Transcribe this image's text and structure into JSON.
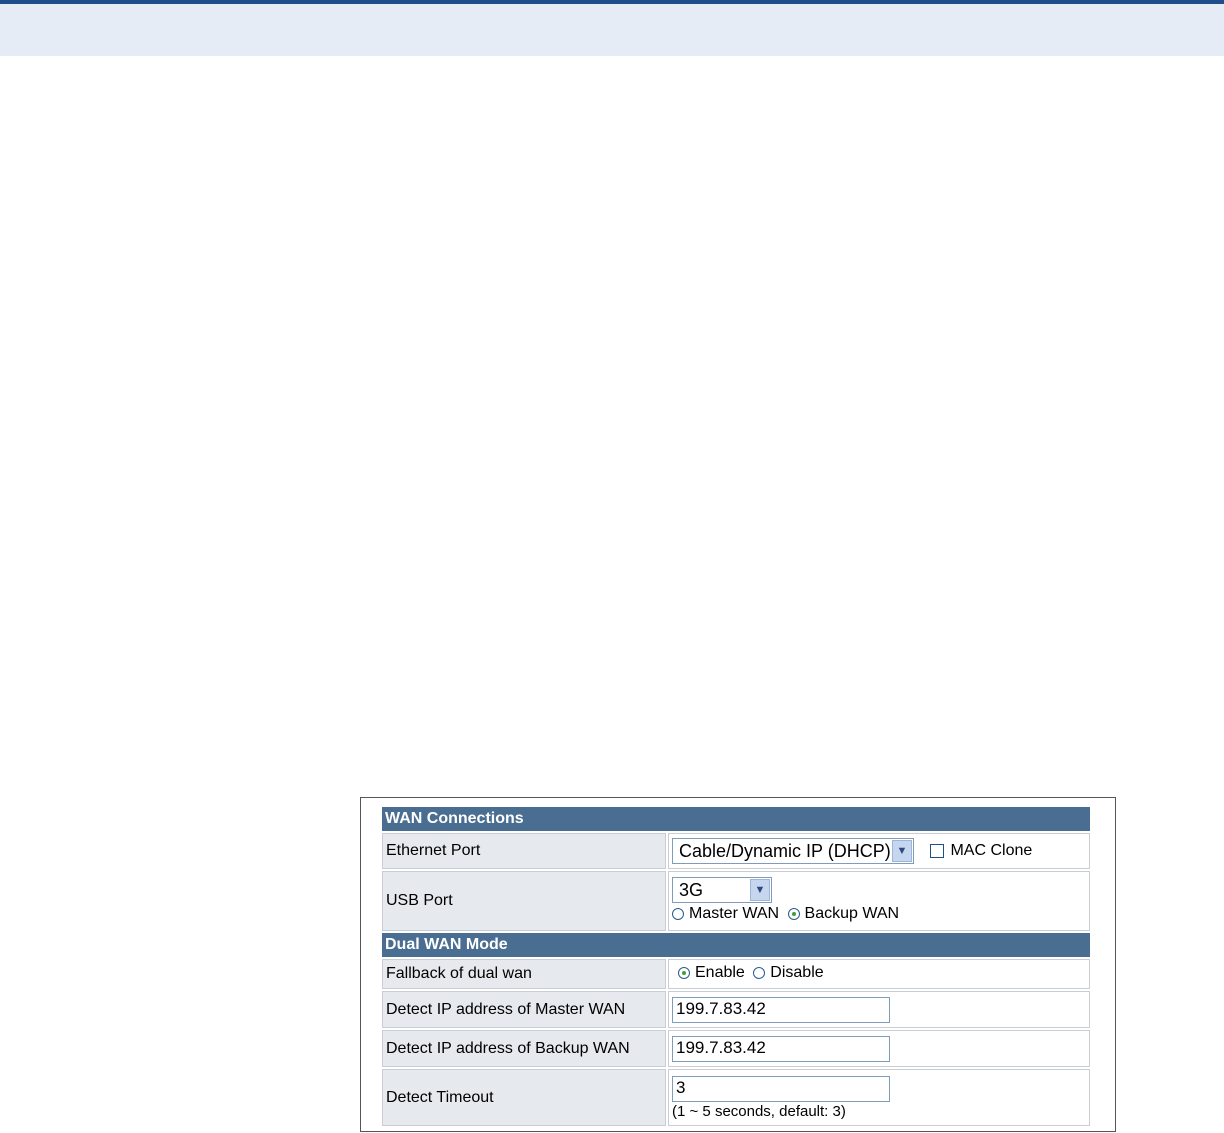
{
  "wan_connections": {
    "title": "WAN Connections",
    "ethernet_port": {
      "label": "Ethernet Port",
      "selected": "Cable/Dynamic IP (DHCP)",
      "mac_clone_label": "MAC Clone",
      "mac_clone_checked": false
    },
    "usb_port": {
      "label": "USB Port",
      "selected": "3G",
      "options": [
        {
          "label": "Master WAN",
          "checked": false
        },
        {
          "label": "Backup WAN",
          "checked": true
        }
      ]
    }
  },
  "dual_wan_mode": {
    "title": "Dual WAN Mode",
    "fallback": {
      "label": "Fallback of dual wan",
      "options": [
        {
          "label": "Enable",
          "checked": true
        },
        {
          "label": "Disable",
          "checked": false
        }
      ]
    },
    "detect_master": {
      "label": "Detect IP address of Master WAN",
      "value": "199.7.83.42"
    },
    "detect_backup": {
      "label": "Detect IP address of Backup WAN",
      "value": "199.7.83.42"
    },
    "detect_timeout": {
      "label": "Detect Timeout",
      "value": "3",
      "hint": "(1 ~ 5 seconds, default: 3)"
    }
  },
  "colors": {
    "header_bg": "#4a6e91",
    "label_bg": "#e6e9ee",
    "top_band": "#e6ecf5",
    "top_rule": "#1f4e8c"
  }
}
